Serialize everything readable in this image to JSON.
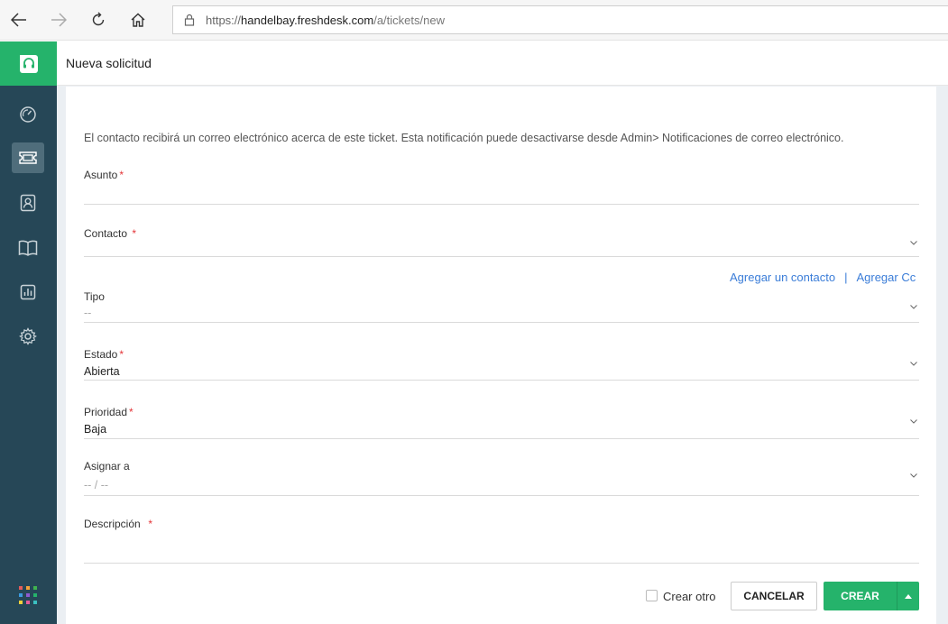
{
  "browser": {
    "url_scheme": "https://",
    "url_host": "handelbay.freshdesk.com",
    "url_path": "/a/tickets/new"
  },
  "header": {
    "title": "Nueva solicitud"
  },
  "form": {
    "notice": "El contacto recibirá un correo electrónico acerca de este ticket. Esta notificación puede desactivarse desde Admin> Notificaciones de correo electrónico.",
    "asunto": {
      "label": "Asunto",
      "required": "*",
      "value": ""
    },
    "contacto": {
      "label": "Contacto",
      "required": "*",
      "value": ""
    },
    "links": {
      "add_contact": "Agregar un contacto",
      "separator": "|",
      "add_cc": "Agregar Cc"
    },
    "tipo": {
      "label": "Tipo",
      "value": "--"
    },
    "estado": {
      "label": "Estado",
      "required": "*",
      "value": "Abierta"
    },
    "prioridad": {
      "label": "Prioridad",
      "required": "*",
      "value": "Baja"
    },
    "asignar": {
      "label": "Asignar a",
      "value": "-- / --"
    },
    "descripcion": {
      "label": "Descripción",
      "required": "*",
      "value": ""
    }
  },
  "actions": {
    "create_another": "Crear otro",
    "cancel": "CANCELAR",
    "create": "CREAR"
  },
  "colors": {
    "brand_green": "#25b36b",
    "sidebar": "#264757",
    "link_blue": "#3b7dd8",
    "required_red": "#e43538"
  }
}
